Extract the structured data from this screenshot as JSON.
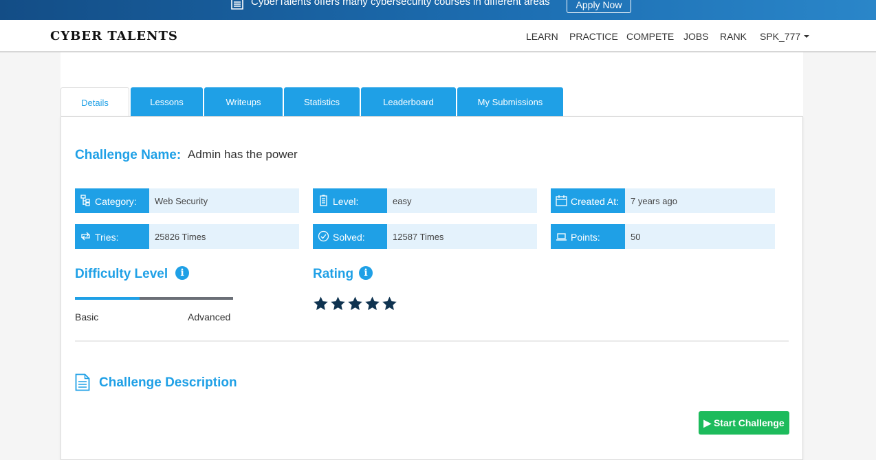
{
  "banner": {
    "message": "CyberTalents offers many cybersecurity courses in different areas",
    "apply_label": "Apply Now"
  },
  "navbar": {
    "brand": "CYBER TALENTS",
    "items": [
      "LEARN",
      "PRACTICE",
      "COMPETE",
      "JOBS",
      "RANK"
    ],
    "user": "SPK_777"
  },
  "tabs": [
    "Details",
    "Lessons",
    "Writeups",
    "Statistics",
    "Leaderboard",
    "My Submissions"
  ],
  "active_tab": "Details",
  "challenge": {
    "name_label": "Challenge Name:",
    "name": "Admin has the power"
  },
  "info": [
    {
      "label": "Category:",
      "value": "Web Security",
      "icon": "sitemap-icon"
    },
    {
      "label": "Level:",
      "value": "easy",
      "icon": "battery-icon"
    },
    {
      "label": "Created At:",
      "value": "7 years ago",
      "icon": "calendar-icon"
    },
    {
      "label": "Tries:",
      "value": "25826 Times",
      "icon": "retweet-icon"
    },
    {
      "label": "Solved:",
      "value": "12587 Times",
      "icon": "check-circle-icon"
    },
    {
      "label": "Points:",
      "value": "50",
      "icon": "laptop-icon"
    }
  ],
  "difficulty": {
    "title": "Difficulty Level",
    "min_label": "Basic",
    "max_label": "Advanced",
    "level": 0.41
  },
  "rating": {
    "title": "Rating",
    "stars": 5,
    "max": 5
  },
  "description": {
    "title": "Challenge Description"
  },
  "start_button": "Start Challenge",
  "colors": {
    "accent": "#1fa0e6",
    "info_bg": "#e4f2fc",
    "star": "#0f3350",
    "start": "#1dbb5c"
  }
}
